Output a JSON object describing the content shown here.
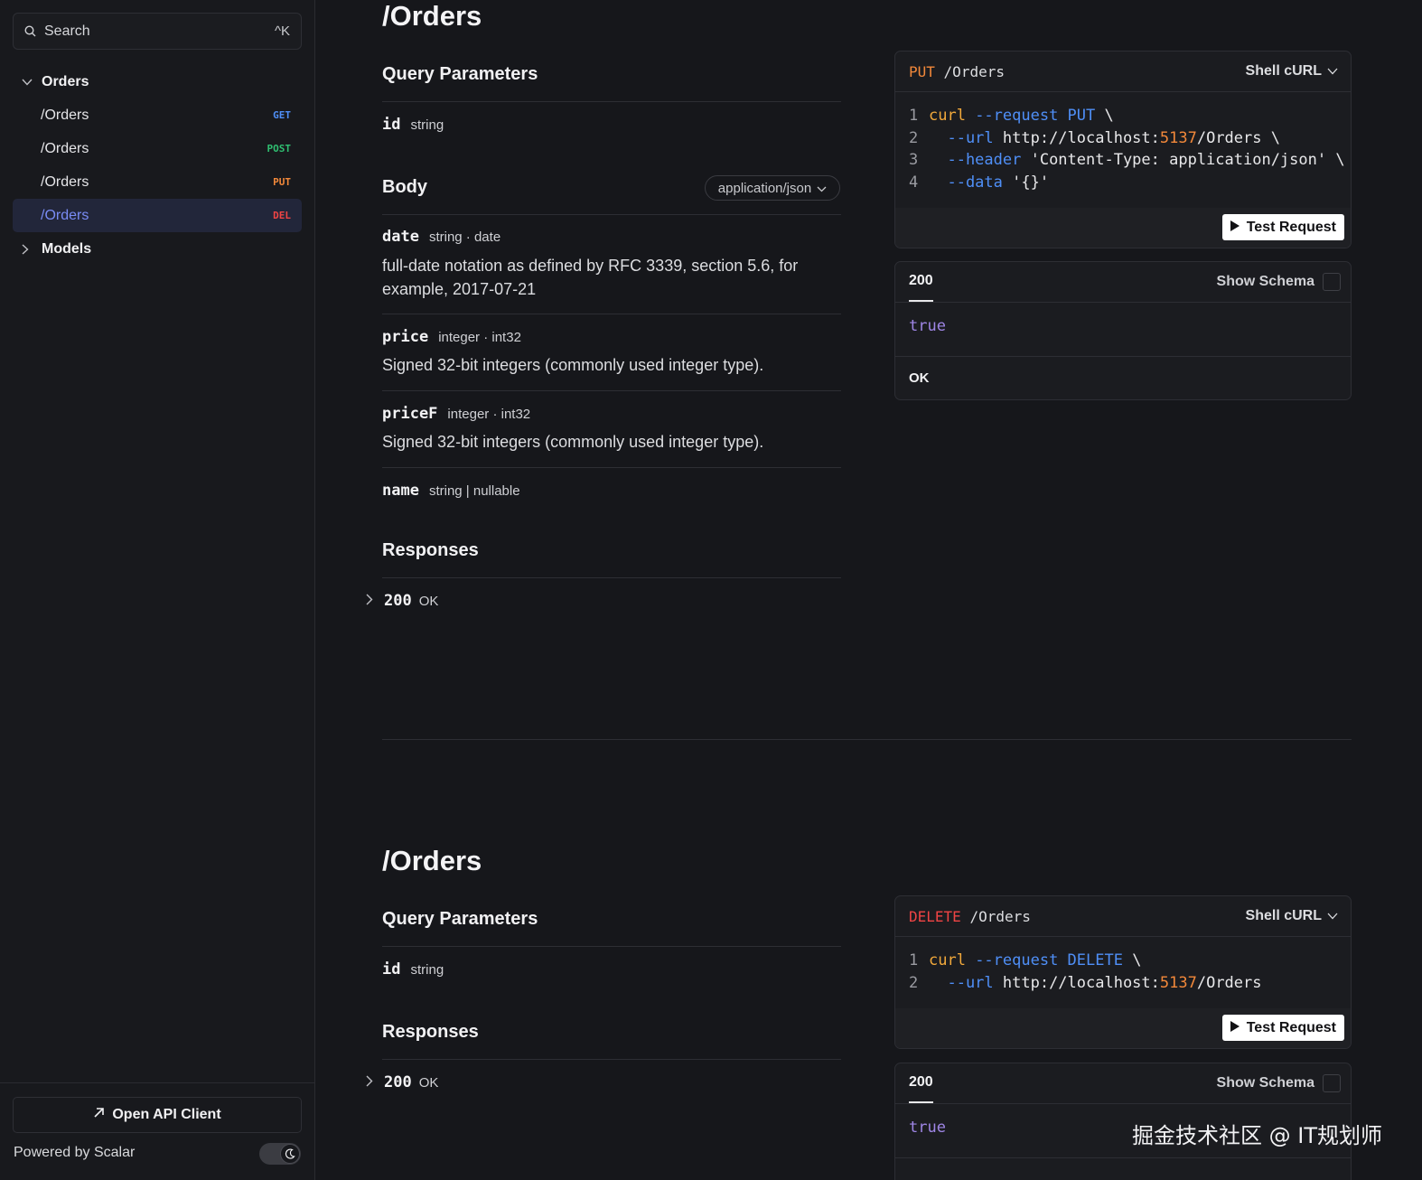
{
  "sidebar": {
    "search_placeholder": "Search",
    "search_shortcut": "^K",
    "groups": [
      {
        "label": "Orders",
        "expanded": true,
        "items": [
          {
            "label": "/Orders",
            "method": "GET"
          },
          {
            "label": "/Orders",
            "method": "POST"
          },
          {
            "label": "/Orders",
            "method": "PUT"
          },
          {
            "label": "/Orders",
            "method": "DEL",
            "active": true
          }
        ]
      },
      {
        "label": "Models",
        "expanded": false
      }
    ],
    "open_client_label": "Open API Client",
    "powered_by": "Powered by Scalar"
  },
  "put_section": {
    "title": "/Orders",
    "query_heading": "Query Parameters",
    "query_params": [
      {
        "name": "id",
        "type": "string"
      }
    ],
    "body_heading": "Body",
    "content_type": "application/json",
    "body_params": [
      {
        "name": "date",
        "type": "string · date",
        "desc": "full-date notation as defined by RFC 3339, section 5.6, for example, 2017-07-21"
      },
      {
        "name": "price",
        "type": "integer · int32",
        "desc": "Signed 32-bit integers (commonly used integer type)."
      },
      {
        "name": "priceF",
        "type": "integer · int32",
        "desc": "Signed 32-bit integers (commonly used integer type)."
      },
      {
        "name": "name",
        "type": "string | nullable",
        "desc": ""
      }
    ],
    "responses_heading": "Responses",
    "responses": [
      {
        "code": "200",
        "text": "OK"
      }
    ],
    "code_card": {
      "method": "PUT",
      "path": "/Orders",
      "language": "Shell cURL",
      "lines": [
        [
          "1",
          "curl",
          " --request",
          " PUT",
          " \\"
        ],
        [
          "2",
          "  --url",
          " http://localhost:",
          "5137",
          "/Orders \\"
        ],
        [
          "3",
          "  --header",
          " 'Content-Type: application/json' \\"
        ],
        [
          "4",
          "  --data",
          " '{}'"
        ]
      ],
      "test_label": "Test Request"
    },
    "response_card": {
      "status": "200",
      "schema_label": "Show Schema",
      "body": "true",
      "desc": "OK"
    }
  },
  "delete_section": {
    "title": "/Orders",
    "query_heading": "Query Parameters",
    "query_params": [
      {
        "name": "id",
        "type": "string"
      }
    ],
    "responses_heading": "Responses",
    "responses": [
      {
        "code": "200",
        "text": "OK"
      }
    ],
    "code_card": {
      "method": "DELETE",
      "path": "/Orders",
      "language": "Shell cURL",
      "lines": [
        [
          "1",
          "curl",
          " --request",
          " DELETE",
          " \\"
        ],
        [
          "2",
          "  --url",
          " http://localhost:",
          "5137",
          "/Orders"
        ]
      ],
      "test_label": "Test Request"
    },
    "response_card": {
      "status": "200",
      "schema_label": "Show Schema",
      "body": "true"
    }
  },
  "watermark": "掘金技术社区 @ IT规划师",
  "colors": {
    "get": "#4f8ff7",
    "post": "#2fbf71",
    "put": "#f2883a",
    "delete": "#ef4444",
    "active_bg": "#22263a",
    "active_text": "#7a8cf5"
  }
}
